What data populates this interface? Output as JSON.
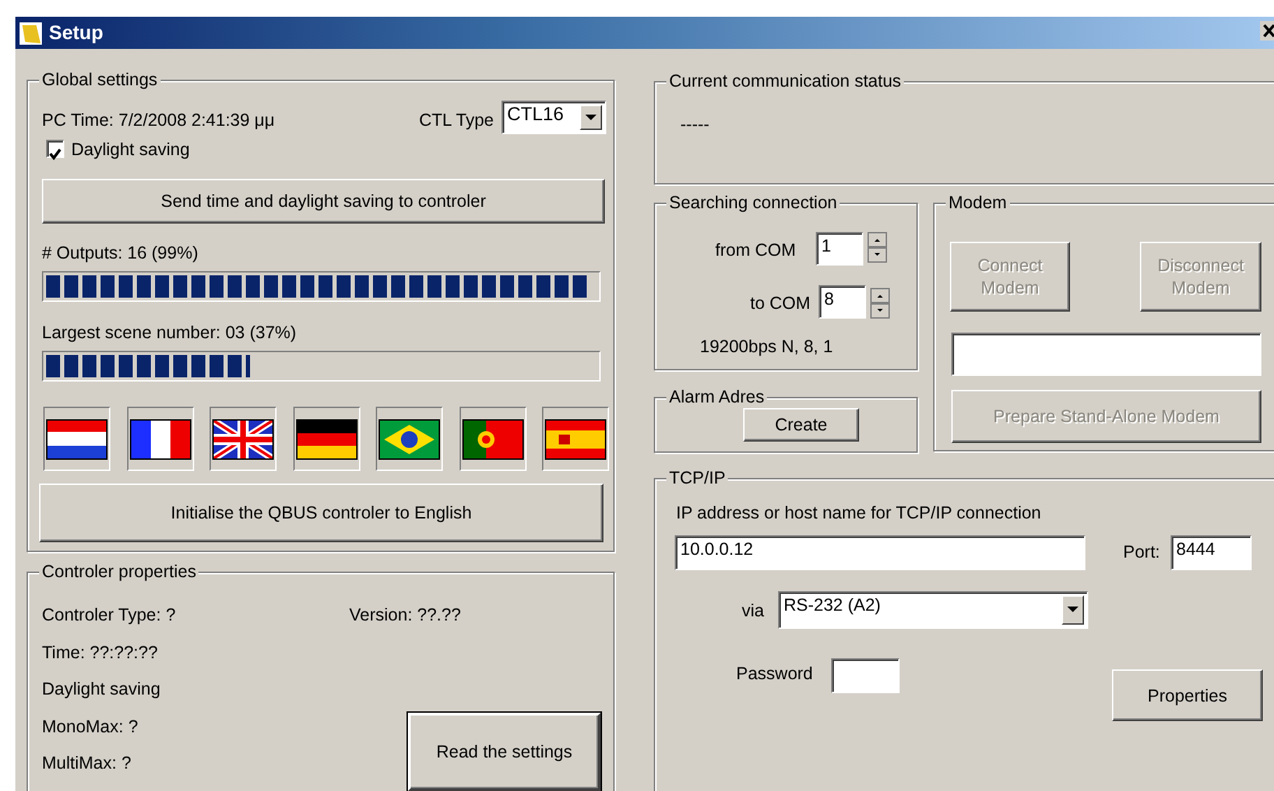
{
  "window": {
    "title": "Setup"
  },
  "global_settings": {
    "title": "Global settings",
    "pc_time": "PC Time: 7/2/2008  2:41:39 μμ",
    "ctl_type_label": "CTL Type",
    "ctl_type_value": "CTL16",
    "daylight_saving": {
      "label": "Daylight saving",
      "checked": true
    },
    "send_button": "Send time and daylight saving to controler",
    "outputs": {
      "label": "# Outputs: 16 (99%)",
      "level": 0.99
    },
    "scene": {
      "label": "Largest scene number: 03 (37%)",
      "level": 0.37
    },
    "init_button": "Initialise the QBUS controler to English"
  },
  "controler_properties": {
    "title": "Controler properties",
    "type": "Controler Type: ?",
    "version": "Version: ??.??",
    "time": "Time: ??:??:??",
    "daylight": "Daylight saving",
    "monomax": "MonoMax: ?",
    "multimax": "MultiMax: ?",
    "read_button": {
      "label": "Read the settings",
      "default": true
    }
  },
  "communication_status": {
    "title": "Current communication status",
    "text": "-----"
  },
  "searching_connection": {
    "title": "Searching connection",
    "from_label": "from COM",
    "from_value": "1",
    "to_label": "to COM",
    "to_value": "8",
    "settings": "19200bps N, 8, 1"
  },
  "alarm": {
    "title": "Alarm Adres",
    "button": "Create"
  },
  "modem": {
    "title": "Modem",
    "connect": {
      "label": "Connect\nModem",
      "disabled": true
    },
    "disconnect": {
      "label": "Disconnect\nModem",
      "disabled": true
    },
    "prepare": {
      "label": "Prepare Stand-Alone Modem",
      "disabled": true
    }
  },
  "tcpip": {
    "title": "TCP/IP",
    "host_label": "IP address or host name for TCP/IP connection",
    "host_value": "10.0.0.12",
    "port_label": "Port:",
    "port_value": "8444",
    "via_label": "via",
    "via_value": "RS-232 (A2)",
    "password_label": "Password",
    "properties_button": "Properties"
  }
}
